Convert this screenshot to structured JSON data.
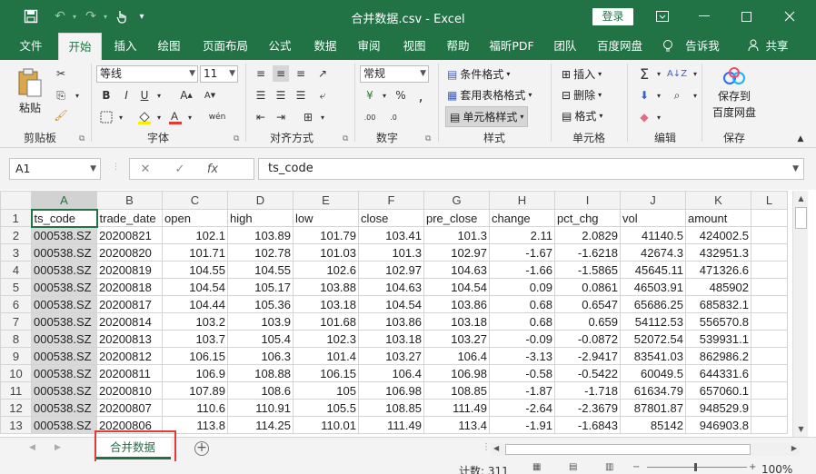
{
  "titlebar": {
    "title": "合并数据.csv  -  Excel",
    "login_label": "登录"
  },
  "menu_tabs": [
    "文件",
    "开始",
    "插入",
    "绘图",
    "页面布局",
    "公式",
    "数据",
    "审阅",
    "视图",
    "帮助",
    "福昕PDF",
    "团队",
    "百度网盘",
    "告诉我",
    "共享"
  ],
  "ribbon": {
    "paste": "粘贴",
    "clipboard": "剪贴板",
    "font_name": "等线",
    "font_size": "11",
    "font_group": "字体",
    "align_group": "对齐方式",
    "number_format": "常规",
    "number_group": "数字",
    "cond_format": "条件格式",
    "table_format": "套用表格格式",
    "cell_style": "单元格样式",
    "style_group": "样式",
    "insert": "插入",
    "delete": "删除",
    "format": "格式",
    "cells_group": "单元格",
    "edit_group": "编辑",
    "save_to": "保存到",
    "baidu": "百度网盘",
    "save_group": "保存"
  },
  "formula_bar": {
    "name_box": "A1",
    "content": "ts_code"
  },
  "columns": [
    "A",
    "B",
    "C",
    "D",
    "E",
    "F",
    "G",
    "H",
    "I",
    "J",
    "K",
    "L"
  ],
  "rows": [
    [
      "ts_code",
      "trade_date",
      "open",
      "high",
      "low",
      "close",
      "pre_close",
      "change",
      "pct_chg",
      "vol",
      "amount"
    ],
    [
      "000538.SZ",
      "20200821",
      "102.1",
      "103.89",
      "101.79",
      "103.41",
      "101.3",
      "2.11",
      "2.0829",
      "41140.5",
      "424002.5"
    ],
    [
      "000538.SZ",
      "20200820",
      "101.71",
      "102.78",
      "101.03",
      "101.3",
      "102.97",
      "-1.67",
      "-1.6218",
      "42674.3",
      "432951.3"
    ],
    [
      "000538.SZ",
      "20200819",
      "104.55",
      "104.55",
      "102.6",
      "102.97",
      "104.63",
      "-1.66",
      "-1.5865",
      "45645.11",
      "471326.6"
    ],
    [
      "000538.SZ",
      "20200818",
      "104.54",
      "105.17",
      "103.88",
      "104.63",
      "104.54",
      "0.09",
      "0.0861",
      "46503.91",
      "485902"
    ],
    [
      "000538.SZ",
      "20200817",
      "104.44",
      "105.36",
      "103.18",
      "104.54",
      "103.86",
      "0.68",
      "0.6547",
      "65686.25",
      "685832.1"
    ],
    [
      "000538.SZ",
      "20200814",
      "103.2",
      "103.9",
      "101.68",
      "103.86",
      "103.18",
      "0.68",
      "0.659",
      "54112.53",
      "556570.8"
    ],
    [
      "000538.SZ",
      "20200813",
      "103.7",
      "105.4",
      "102.3",
      "103.18",
      "103.27",
      "-0.09",
      "-0.0872",
      "52072.54",
      "539931.1"
    ],
    [
      "000538.SZ",
      "20200812",
      "106.15",
      "106.3",
      "101.4",
      "103.27",
      "106.4",
      "-3.13",
      "-2.9417",
      "83541.03",
      "862986.2"
    ],
    [
      "000538.SZ",
      "20200811",
      "106.9",
      "108.88",
      "106.15",
      "106.4",
      "106.98",
      "-0.58",
      "-0.5422",
      "60049.5",
      "644331.6"
    ],
    [
      "000538.SZ",
      "20200810",
      "107.89",
      "108.6",
      "105",
      "106.98",
      "108.85",
      "-1.87",
      "-1.718",
      "61634.79",
      "657060.1"
    ],
    [
      "000538.SZ",
      "20200807",
      "110.6",
      "110.91",
      "105.5",
      "108.85",
      "111.49",
      "-2.64",
      "-2.3679",
      "87801.87",
      "948529.9"
    ],
    [
      "000538.SZ",
      "20200806",
      "113.8",
      "114.25",
      "110.01",
      "111.49",
      "113.4",
      "-1.91",
      "-1.6843",
      "85142",
      "946903.8"
    ]
  ],
  "sheet_tab": "合并数据",
  "status": {
    "count": "计数: 311",
    "zoom": "100%"
  },
  "colors": {
    "accent": "#217346",
    "highlight_outline": "#e53935"
  }
}
